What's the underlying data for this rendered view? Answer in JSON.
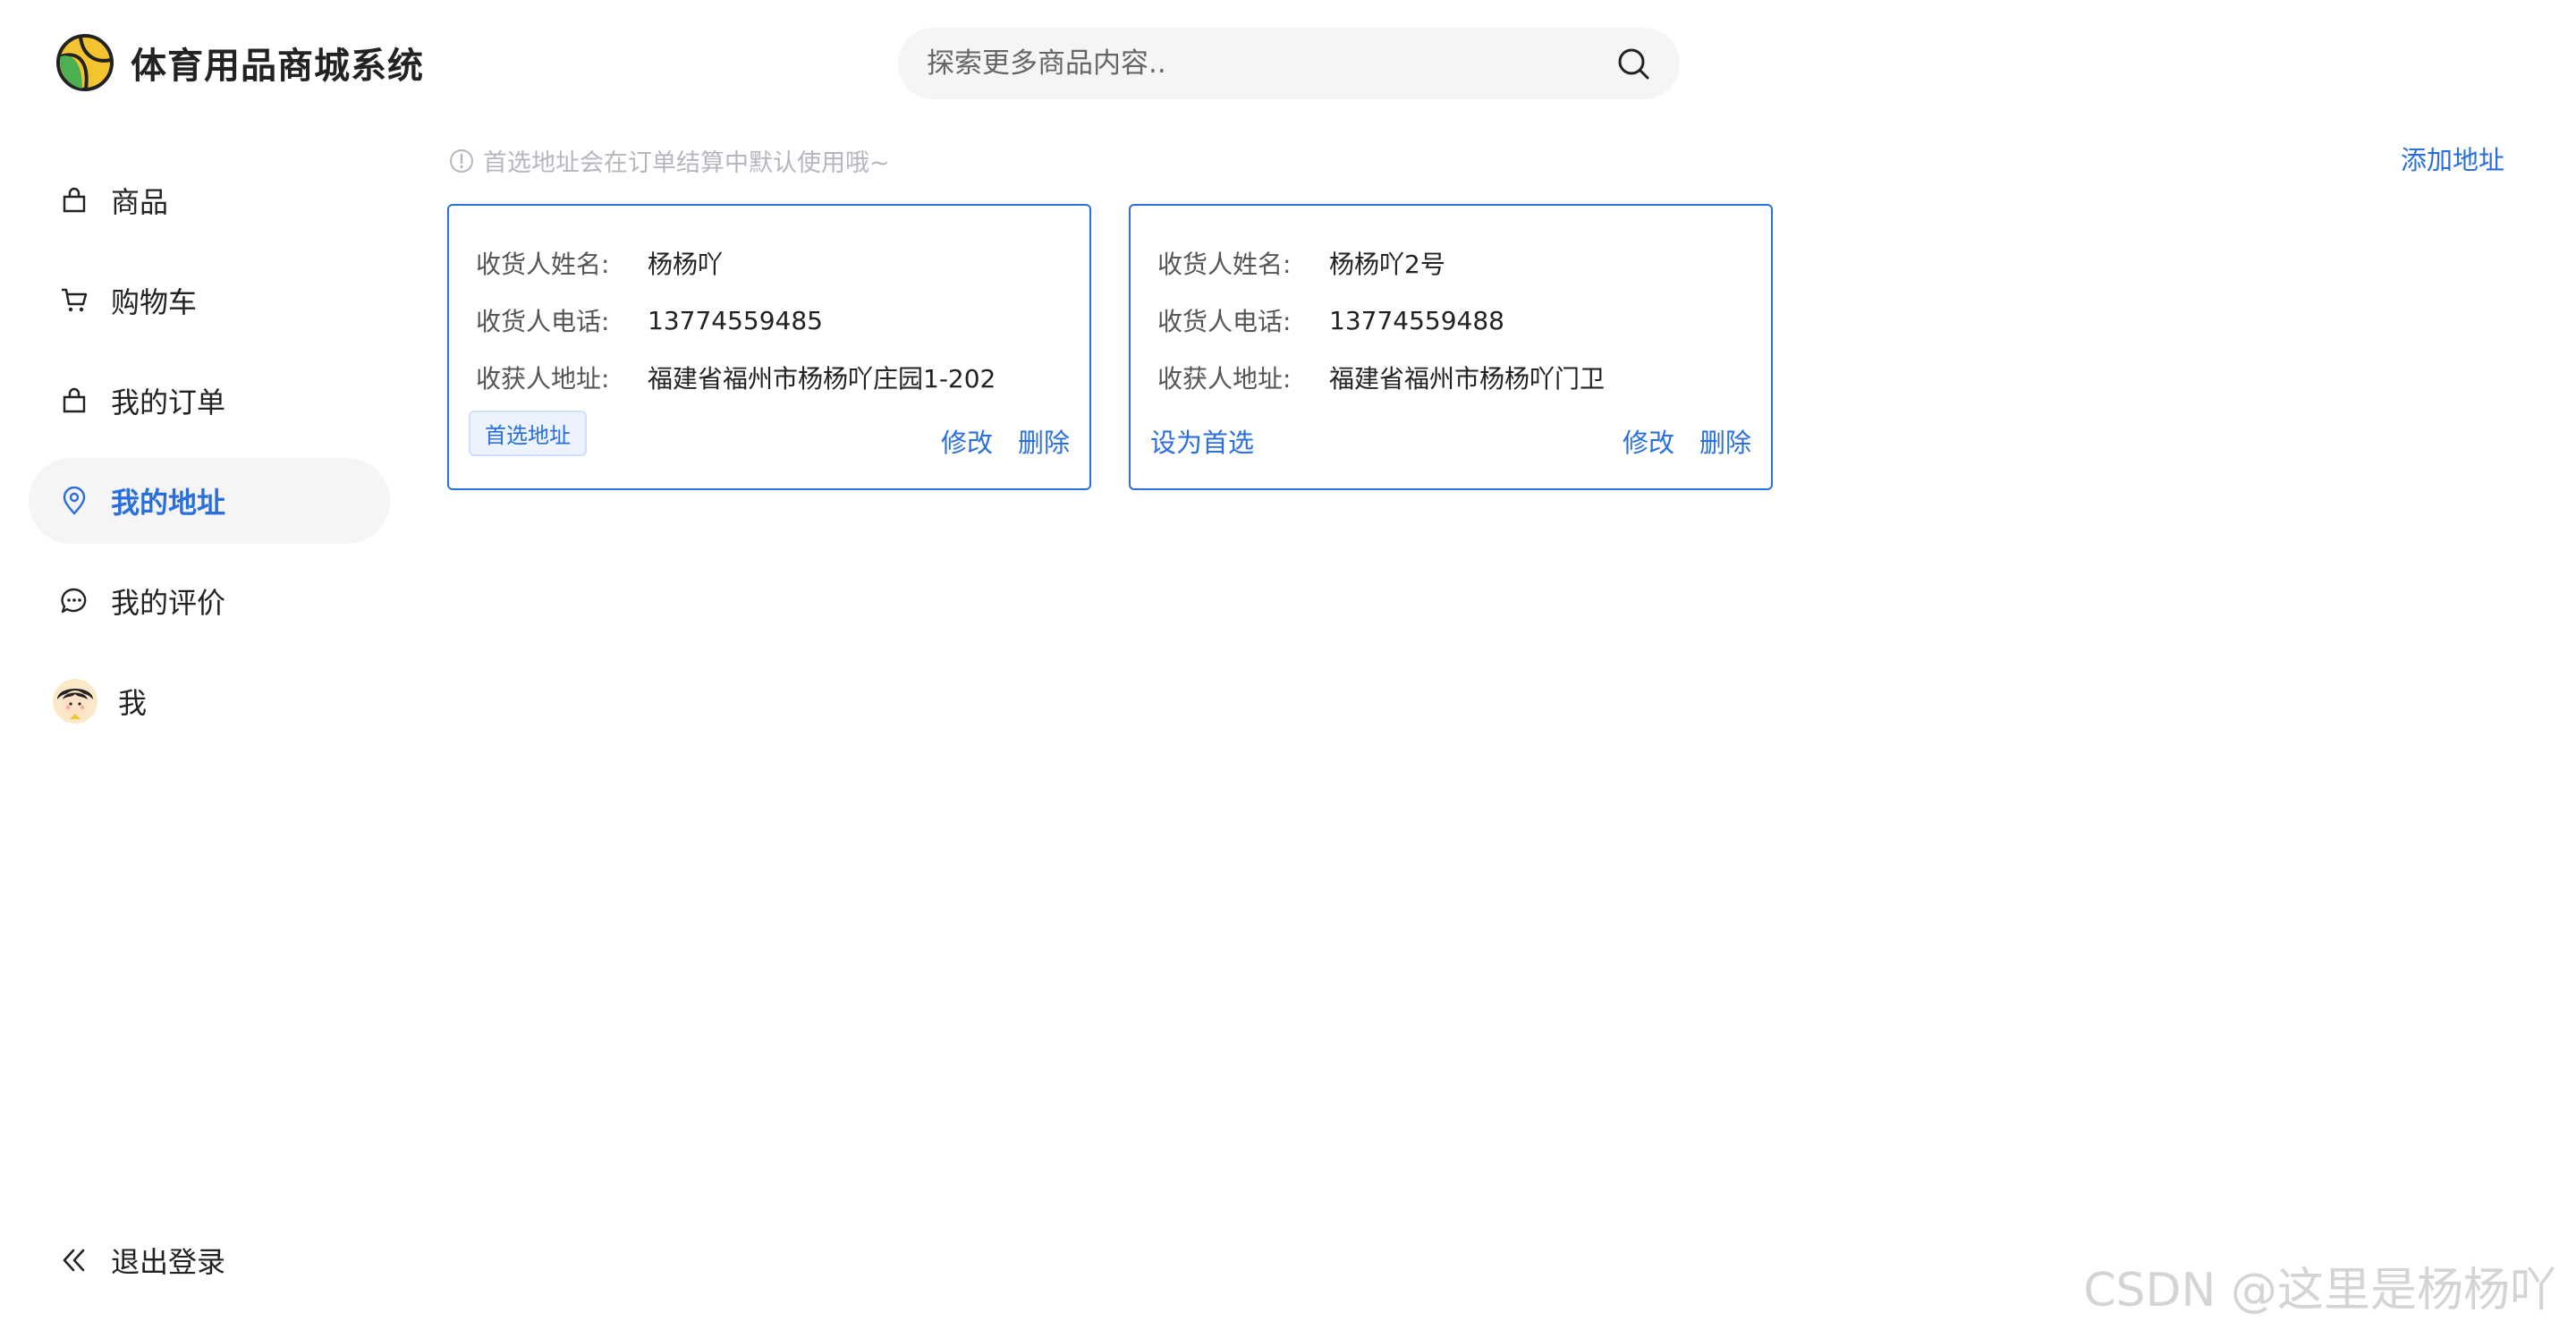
{
  "app": {
    "title": "体育用品商城系统"
  },
  "search": {
    "placeholder": "探索更多商品内容.."
  },
  "sidebar": {
    "items": [
      {
        "label": "商品",
        "icon": "shopping-bag-icon"
      },
      {
        "label": "购物车",
        "icon": "cart-icon"
      },
      {
        "label": "我的订单",
        "icon": "orders-bag-icon"
      },
      {
        "label": "我的地址",
        "icon": "location-pin-icon",
        "active": true
      },
      {
        "label": "我的评价",
        "icon": "comment-icon"
      },
      {
        "label": "我",
        "icon": "avatar-icon"
      }
    ],
    "logout": "退出登录"
  },
  "main": {
    "tip": "首选地址会在订单结算中默认使用哦~",
    "add_address": "添加地址",
    "labels": {
      "name": "收货人姓名:",
      "phone": "收货人电话:",
      "address": "收获人地址:"
    },
    "edit_label": "修改",
    "delete_label": "删除",
    "default_badge": "首选地址",
    "set_default_label": "设为首选",
    "addresses": [
      {
        "name": "杨杨吖",
        "phone": "13774559485",
        "address": "福建省福州市杨杨吖庄园1-202",
        "is_default": true
      },
      {
        "name": "杨杨吖2号",
        "phone": "13774559488",
        "address": "福建省福州市杨杨吖门卫",
        "is_default": false
      }
    ]
  },
  "watermark": "CSDN @这里是杨杨吖",
  "colors": {
    "accent": "#2a6fdb",
    "active_bg": "#f5f5f5",
    "badge_bg": "#ecf3ff"
  }
}
